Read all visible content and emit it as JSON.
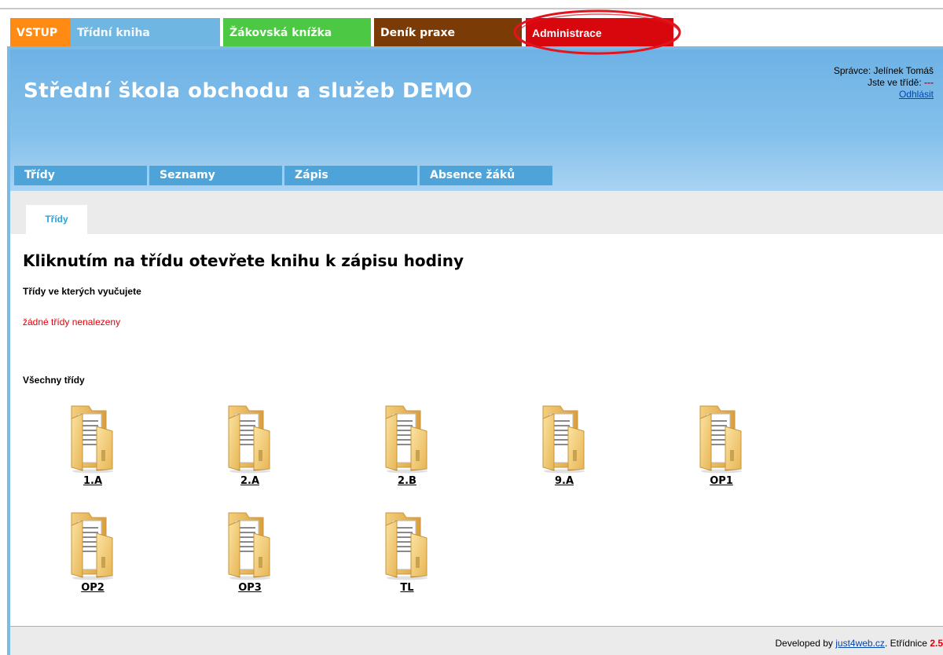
{
  "top_tabs": {
    "vstup": "VSTUP",
    "tridni_kniha": "Třídní kniha",
    "zakovska_knizka": "Žákovská knížka",
    "denik_praxe": "Deník praxe",
    "administrace": "Administrace"
  },
  "header": {
    "school_name": "Střední škola obchodu a služeb DEMO",
    "admin_label": "Správce: Jelínek Tomáš",
    "class_label": "Jste ve třídě:",
    "class_value": "---",
    "logout": "Odhlásit"
  },
  "subnav": [
    "Třídy",
    "Seznamy",
    "Zápis",
    "Absence žáků"
  ],
  "inner_tab": "Třídy",
  "content": {
    "heading": "Kliknutím na třídu otevřete knihu k zápisu hodiny",
    "teaching_heading": "Třídy ve kterých vyučujete",
    "none_found": "žádné třídy nenalezeny",
    "all_heading": "Všechny třídy",
    "classes": [
      "1.A",
      "2.A",
      "2.B",
      "9.A",
      "OP1",
      "OP2",
      "OP3",
      "TL"
    ]
  },
  "footer": {
    "developed_by": "Developed by",
    "link": "just4web.cz",
    "product": ". Etřídnice",
    "version": "2.5"
  },
  "colors": {
    "vstup": "#ff8a14",
    "tridni_kniha": "#6fb6e3",
    "zakovska_knizka": "#4cc845",
    "denik_praxe": "#7a3b07",
    "administrace": "#d8060d",
    "highlight_ellipse": "#e3141e"
  }
}
